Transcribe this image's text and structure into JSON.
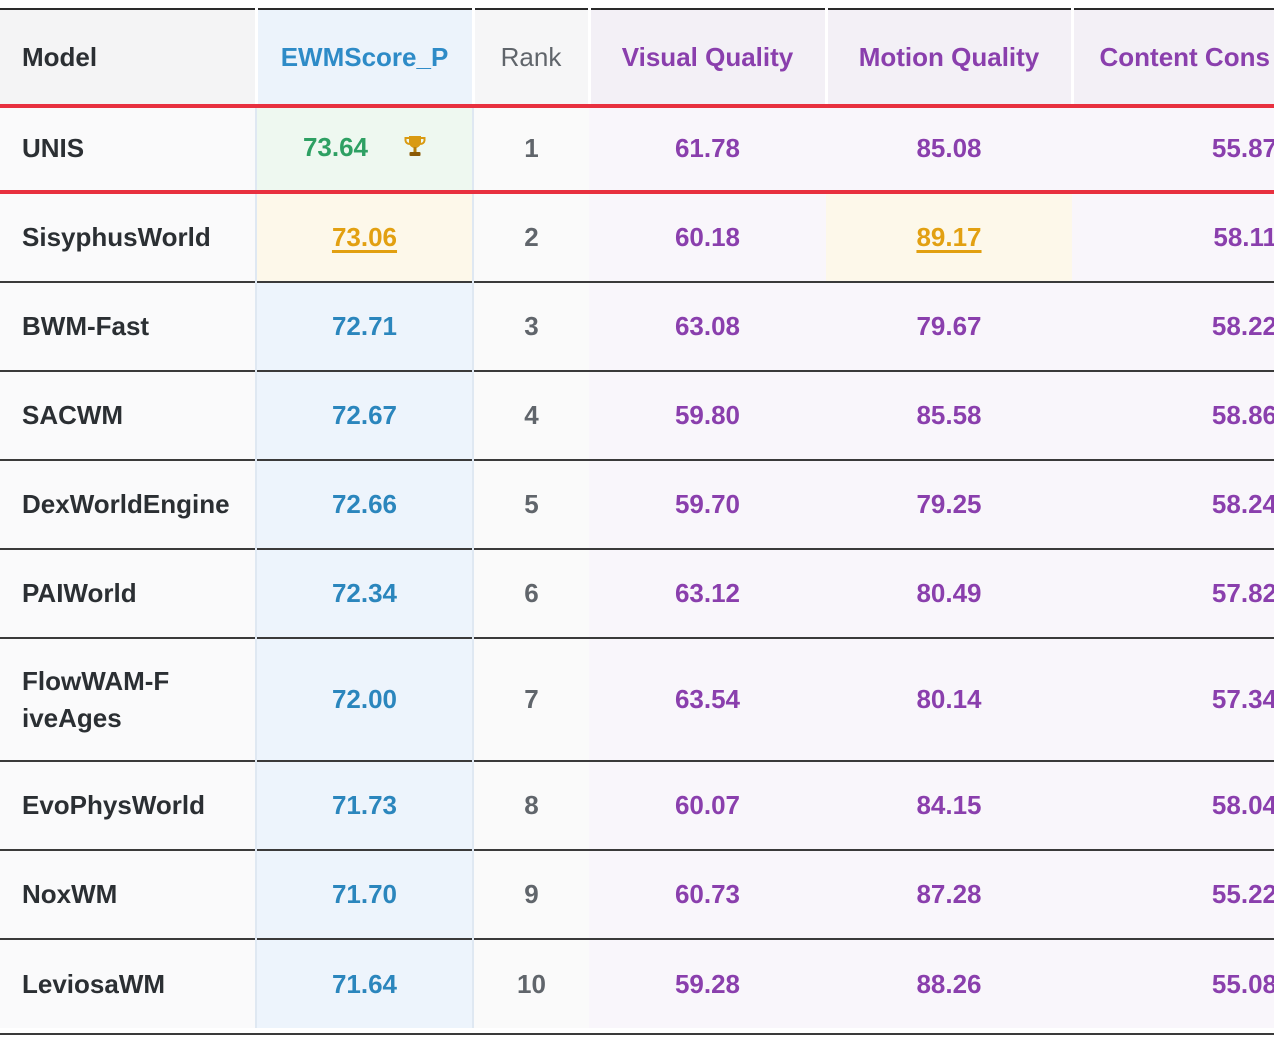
{
  "table": {
    "columns": {
      "model": "Model",
      "ewm": "EWMScore_P",
      "rank": "Rank",
      "vq": "Visual Quality",
      "mq": "Motion Quality",
      "cc": "Content Cons"
    },
    "rows": [
      {
        "model": "UNIS",
        "ewm": "73.64",
        "rank": "1",
        "vq": "61.78",
        "mq": "85.08",
        "cc": "55.87"
      },
      {
        "model": "SisyphusWorld",
        "ewm": "73.06",
        "rank": "2",
        "vq": "60.18",
        "mq": "89.17",
        "cc": "58.11"
      },
      {
        "model": "BWM-Fast",
        "ewm": "72.71",
        "rank": "3",
        "vq": "63.08",
        "mq": "79.67",
        "cc": "58.22"
      },
      {
        "model": "SACWM",
        "ewm": "72.67",
        "rank": "4",
        "vq": "59.80",
        "mq": "85.58",
        "cc": "58.86"
      },
      {
        "model": "DexWorldEngine",
        "ewm": "72.66",
        "rank": "5",
        "vq": "59.70",
        "mq": "79.25",
        "cc": "58.24"
      },
      {
        "model": "PAIWorld",
        "ewm": "72.34",
        "rank": "6",
        "vq": "63.12",
        "mq": "80.49",
        "cc": "57.82"
      },
      {
        "model": "FlowWAM-FiveAges",
        "ewm": "72.00",
        "rank": "7",
        "vq": "63.54",
        "mq": "80.14",
        "cc": "57.34"
      },
      {
        "model": "EvoPhysWorld",
        "ewm": "71.73",
        "rank": "8",
        "vq": "60.07",
        "mq": "84.15",
        "cc": "58.04"
      },
      {
        "model": "NoxWM",
        "ewm": "71.70",
        "rank": "9",
        "vq": "60.73",
        "mq": "87.28",
        "cc": "55.22"
      },
      {
        "model": "LeviosaWM",
        "ewm": "71.64",
        "rank": "10",
        "vq": "59.28",
        "mq": "88.26",
        "cc": "55.08"
      }
    ]
  },
  "icons": {
    "top_score": "trophy-icon"
  },
  "colors": {
    "highlight_border": "#e8303f",
    "first_place_green": "#2ea063",
    "second_best_gold": "#e2a011",
    "ewm_blue": "#2b86bd",
    "metric_purple": "#8a3fad"
  }
}
